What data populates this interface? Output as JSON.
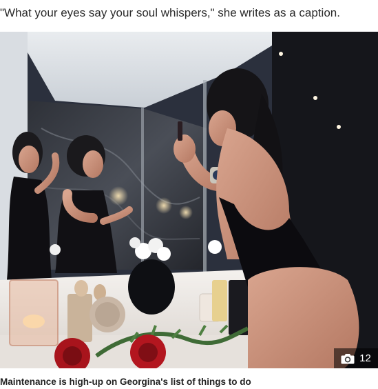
{
  "article": {
    "quote_caption": "\"What your eyes say your soul whispers,\" she writes as a caption.",
    "image_caption": "Maintenance is high-up on Georgina's list of things to do",
    "gallery": {
      "count": "12",
      "icon": "camera-icon"
    }
  },
  "colors": {
    "badge_bg": "#000000",
    "badge_text": "#ffffff",
    "caption_text": "#222222"
  }
}
